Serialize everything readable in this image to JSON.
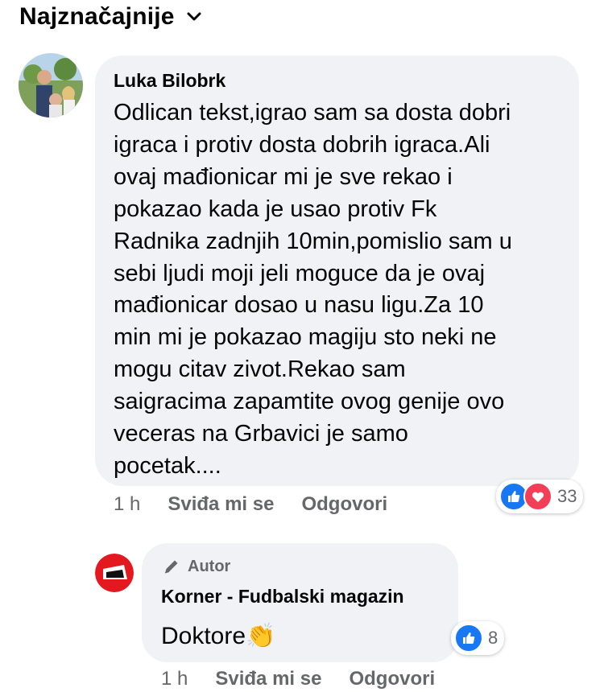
{
  "sort": {
    "label": "Najznačajnije"
  },
  "comment": {
    "author": "Luka Bilobrk",
    "text": "Odlican tekst,igrao sam sa dosta dobri\nigraca i protiv dosta dobrih igraca.Ali\novaj mađionicar mi je sve rekao i\npokazao kada je usao protiv Fk\nRadnika zadnjih 10min,pomislio sam u\nsebi ljudi moji jeli moguce da je ovaj\nmađionicar dosao u nasu ligu.Za 10\nmin mi je pokazao magiju sto neki ne\nmogu citav zivot.Rekao sam\nsaigracima zapamtite ovog genije ovo\nveceras na Grbavici je samo\npocetak....",
    "time": "1 h",
    "like_label": "Sviđa mi se",
    "reply_label": "Odgovori",
    "reaction_count": "33"
  },
  "reply": {
    "badge": "Autor",
    "author": "Korner - Fudbalski magazin",
    "text": "Doktore",
    "emoji": "👏",
    "time": "1 h",
    "like_label": "Sviđa mi se",
    "reply_label": "Odgovori",
    "reaction_count": "8"
  },
  "colors": {
    "bubble": "#f0f2f5",
    "secondary_text": "#65676b",
    "like": "#1877f2",
    "love": "#f33e58",
    "brand_red": "#e4181f"
  }
}
